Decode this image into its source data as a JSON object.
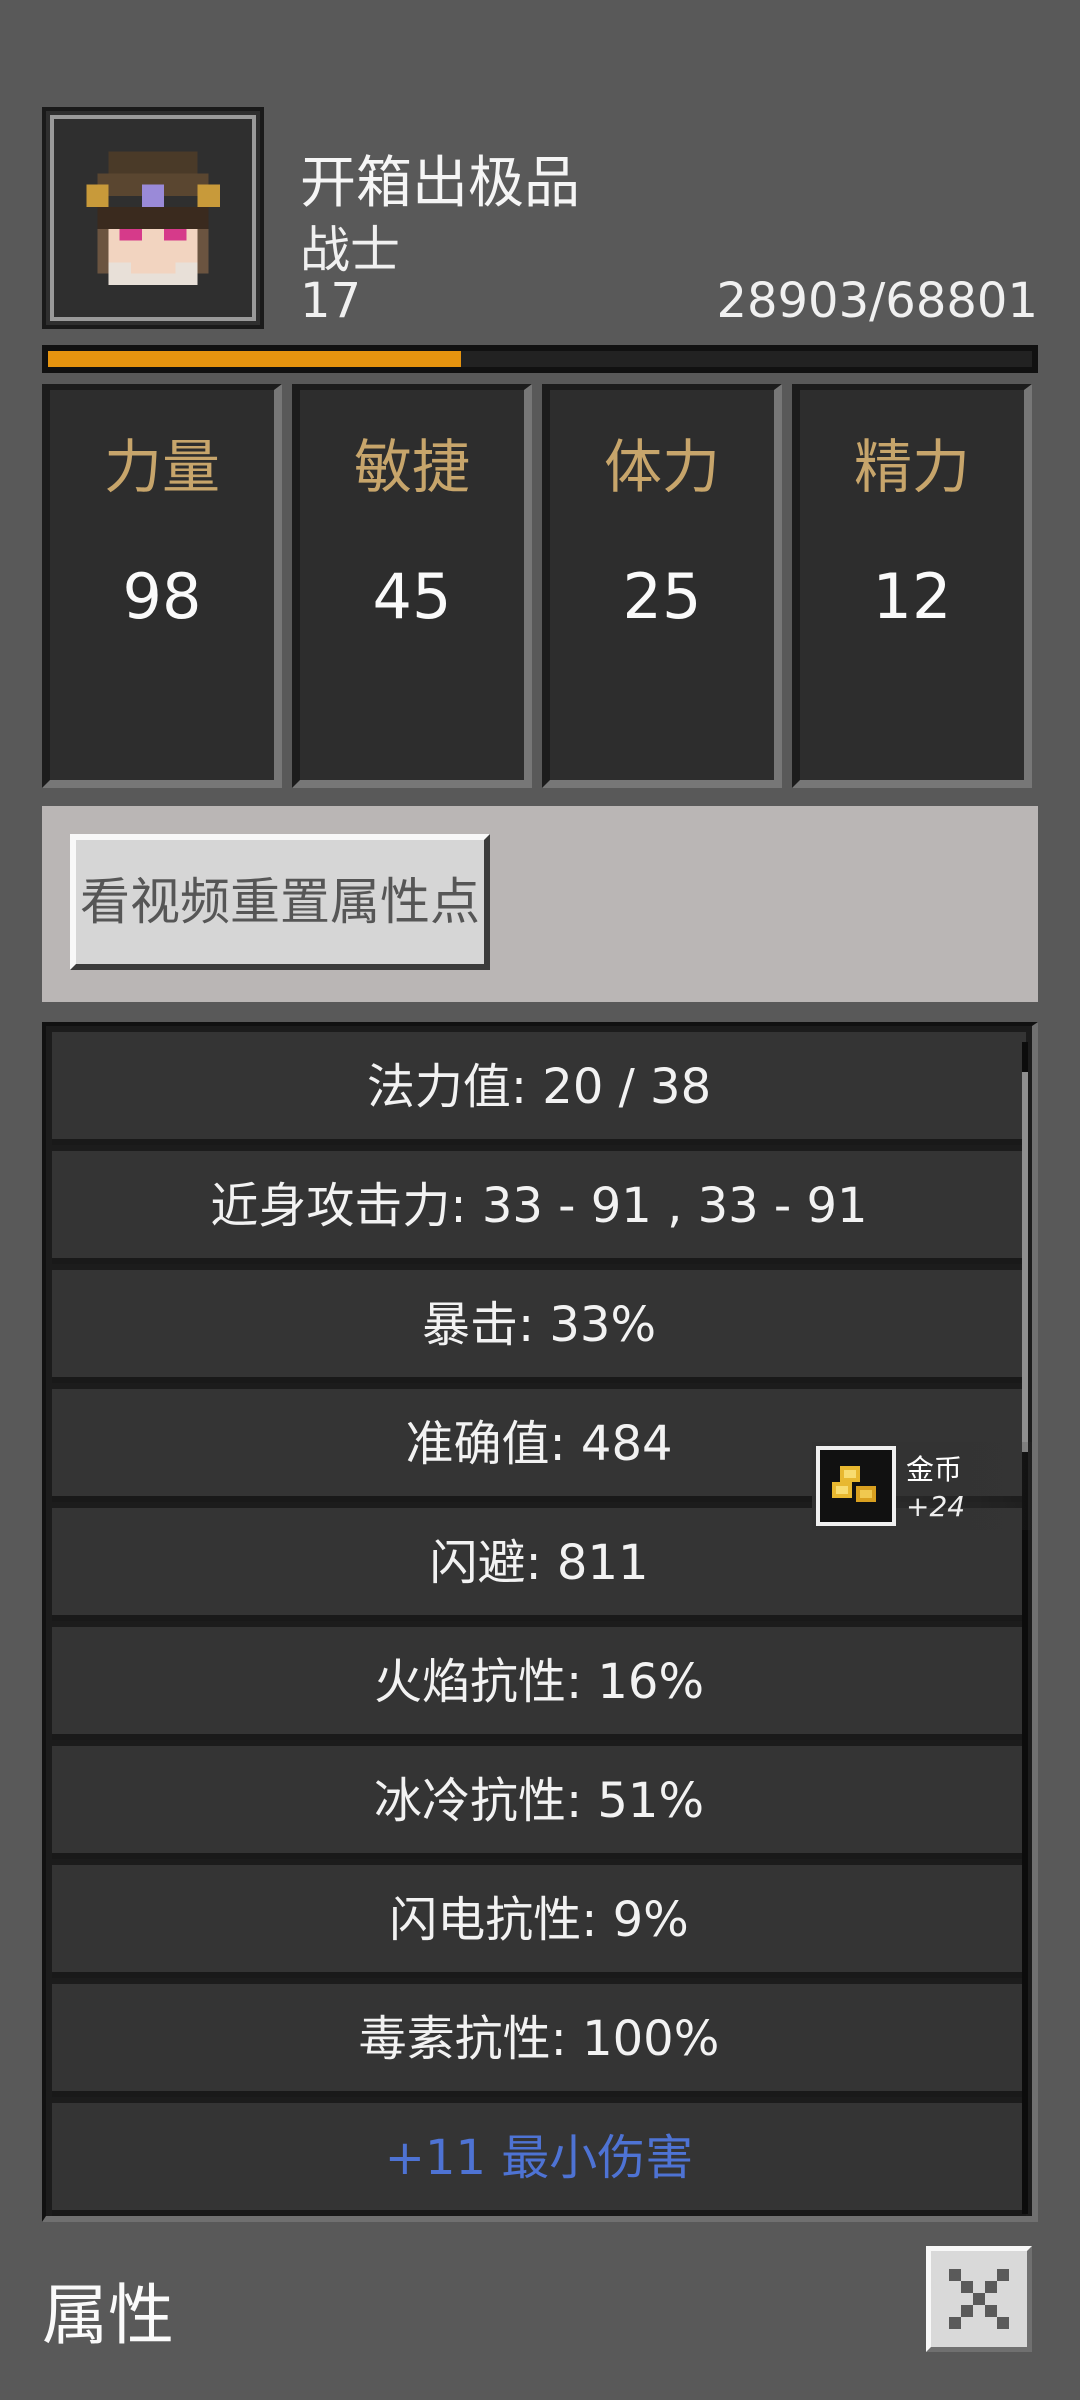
{
  "character": {
    "name": "开箱出极品",
    "class": "战士",
    "level": "17",
    "experience": "28903/68801",
    "exp_progress": 0.42
  },
  "stats": [
    {
      "label": "力量",
      "value": "98"
    },
    {
      "label": "敏捷",
      "value": "45"
    },
    {
      "label": "体力",
      "value": "25"
    },
    {
      "label": "精力",
      "value": "12"
    }
  ],
  "reset_button": {
    "label": "看视频重置属性点"
  },
  "attributes": [
    "法力值: 20 / 38",
    "近身攻击力: 33 - 91 , 33 - 91",
    "暴击: 33%",
    "准确值: 484",
    "闪避: 811",
    "火焰抗性: 16%",
    "冰冷抗性: 51%",
    "闪电抗性: 9%",
    "毒素抗性: 100%",
    "+11 最小伤害"
  ],
  "pickup_notice": {
    "item": "金币",
    "amount": "+24",
    "icon": "gold-coin-icon"
  },
  "footer": {
    "title": "属性",
    "close_icon": "close-icon"
  },
  "colors": {
    "exp_bar": "#e6940f",
    "stat_label": "#c7a56b",
    "bonus_text": "#4e73d4"
  }
}
